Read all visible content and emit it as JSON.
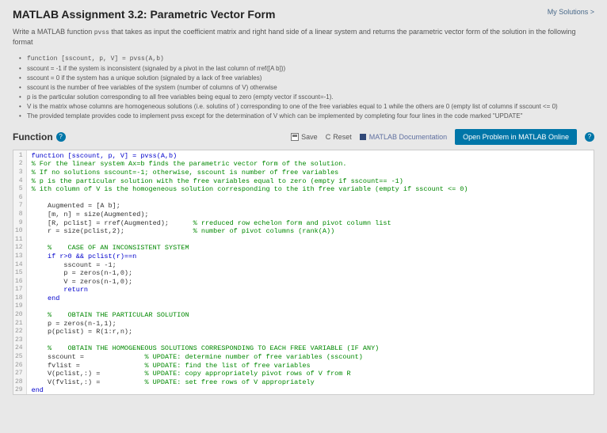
{
  "header": {
    "title": "MATLAB Assignment 3.2: Parametric Vector Form",
    "my_solutions": "My Solutions >"
  },
  "instr": {
    "lead1": "Write a MATLAB function ",
    "func": "pvss",
    "lead2": " that takes as input the coefficient matrix and right hand side  of a linear system  and returns the parametric vector form of the solution in the following format"
  },
  "bullets": [
    "function [sscount, p, V] = pvss(A,b)",
    "sscount = -1 if the system is inconsistent (signaled by a pivot in the last column of rref([A b]))",
    "sscount = 0 if the system has a unique solution (signaled by a lack of free variables)",
    "sscount is the number of free variables of the system (number of columns of V) otherwise",
    "p is the particular solution corresponding to all free variables being equal to zero (empty vector if sscount=-1).",
    "V is the matrix whose columns are homogeneous solutions (i.e. solutins of ) corresponding to one of the free variables equal to 1 while the others are 0 (empty list of columns if sscount <= 0)",
    "The provided template provides code to implement pvss except for the determination of V which can be implemented by completing four four lines in the code marked \"UPDATE\""
  ],
  "funcbar": {
    "label": "Function",
    "save": "Save",
    "reset": "Reset",
    "doc": "MATLAB Documentation",
    "open": "Open Problem in MATLAB Online"
  },
  "code_lines": [
    {
      "t": "function [sscount, p, V] = pvss(A,b)",
      "cls": "kw"
    },
    {
      "t": "% For the linear system Ax=b finds the parametric vector form of the solution.",
      "cls": "com"
    },
    {
      "t": "% If no solutions sscount=-1; otherwise, sscount is number of free variables",
      "cls": "com"
    },
    {
      "t": "% p is the particular solution with the free variables equal to zero (empty if sscount== -1)",
      "cls": "com"
    },
    {
      "t": "% ith column of V is the homogeneous solution corresponding to the ith free variable (empty if sscount <= 0)",
      "cls": "com"
    },
    {
      "t": "",
      "cls": ""
    },
    {
      "t": "    Augmented = [A b];",
      "cls": ""
    },
    {
      "t": "    [m, n] = size(Augmented);",
      "cls": ""
    },
    {
      "t": "    [R, pclist] = rref(Augmented);      % rreduced row echelon form and pivot column list",
      "cls": "mix1"
    },
    {
      "t": "    r = size(pclist,2);                 % number of pivot columns (rank(A))",
      "cls": "mix1"
    },
    {
      "t": "",
      "cls": ""
    },
    {
      "t": "    %    CASE OF AN INCONSISTENT SYSTEM",
      "cls": "com"
    },
    {
      "t": "    if r>0 && pclist(r)==n",
      "cls": "kw"
    },
    {
      "t": "        sscount = -1;",
      "cls": ""
    },
    {
      "t": "        p = zeros(n-1,0);",
      "cls": ""
    },
    {
      "t": "        V = zeros(n-1,0);",
      "cls": ""
    },
    {
      "t": "        return",
      "cls": "kw"
    },
    {
      "t": "    end",
      "cls": "kw"
    },
    {
      "t": "",
      "cls": ""
    },
    {
      "t": "    %    OBTAIN THE PARTICULAR SOLUTION",
      "cls": "com"
    },
    {
      "t": "    p = zeros(n-1,1);",
      "cls": ""
    },
    {
      "t": "    p(pclist) = R(1:r,n);",
      "cls": ""
    },
    {
      "t": "",
      "cls": ""
    },
    {
      "t": "    %    OBTAIN THE HOMOGENEOUS SOLUTIONS CORRESPONDING TO EACH FREE VARIABLE (IF ANY)",
      "cls": "com"
    },
    {
      "t": "    sscount =               % UPDATE: determine number of free variables (sscount)",
      "cls": "mix2"
    },
    {
      "t": "    fvlist =                % UPDATE: find the list of free variables",
      "cls": "mix2"
    },
    {
      "t": "    V(pclist,:) =           % UPDATE: copy appropriately pivot rows of V from R",
      "cls": "mix2"
    },
    {
      "t": "    V(fvlist,:) =           % UPDATE: set free rows of V appropriately",
      "cls": "mix2"
    },
    {
      "t": "end",
      "cls": "kw"
    }
  ]
}
